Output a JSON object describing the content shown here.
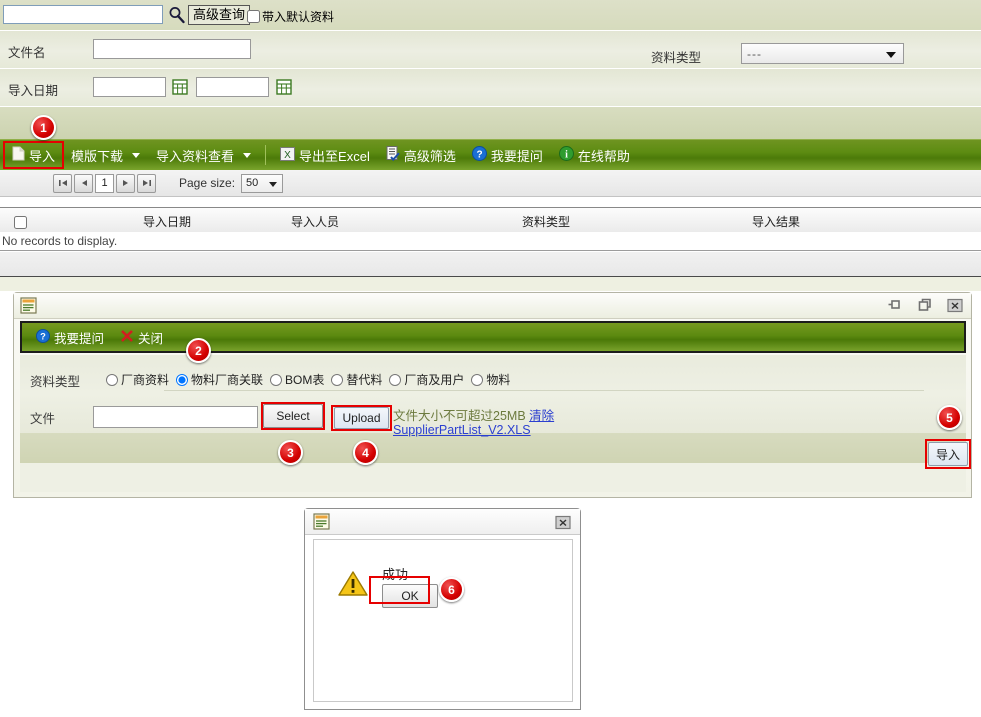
{
  "search": {
    "input_value": "",
    "advanced_query_label": "高级查询",
    "checkbox_label": "带入默认资料",
    "search_icon": "search-icon"
  },
  "filters": {
    "filename_label": "文件名",
    "filename_value": "",
    "import_date_label": "导入日期",
    "date_from": "",
    "date_to": "",
    "doc_type_label": "资料类型",
    "doc_type_value": "---"
  },
  "toolbar": {
    "items": [
      {
        "label": "导入",
        "icon": "import-icon",
        "caret": false
      },
      {
        "label": "模版下载",
        "icon": "",
        "caret": true
      },
      {
        "label": "导入资料查看",
        "icon": "",
        "caret": true
      },
      {
        "label": "导出至Excel",
        "icon": "excel-icon",
        "caret": false
      },
      {
        "label": "高级筛选",
        "icon": "filter-icon",
        "caret": false
      },
      {
        "label": "我要提问",
        "icon": "question-icon",
        "caret": false
      },
      {
        "label": "在线帮助",
        "icon": "info-icon",
        "caret": false
      }
    ]
  },
  "pager": {
    "first_label": "|◀",
    "prev_label": "◀",
    "page_number": "1",
    "next_label": "▶",
    "last_label": "▶|",
    "page_size_label": "Page size:",
    "page_size_value": "50"
  },
  "grid": {
    "columns": [
      "导入日期",
      "导入人员",
      "资料类型",
      "导入结果"
    ],
    "empty_text": "No records to display.",
    "rows": []
  },
  "modal": {
    "title_icon": "document-icon",
    "window_buttons": [
      "pin-icon",
      "restore-icon",
      "close-icon"
    ],
    "toolbar": [
      {
        "label": "我要提问",
        "icon": "question-icon"
      },
      {
        "label": "关闭",
        "icon": "close-x-icon"
      }
    ],
    "doc_type_label": "资料类型",
    "radio_options": [
      {
        "label": "厂商资料",
        "selected": false
      },
      {
        "label": "物料厂商关联",
        "selected": true
      },
      {
        "label": "BOM表",
        "selected": false
      },
      {
        "label": "替代料",
        "selected": false
      },
      {
        "label": "厂商及用户",
        "selected": false
      },
      {
        "label": "物料",
        "selected": false
      }
    ],
    "file_label": "文件",
    "file_input_value": "",
    "select_button": "Select",
    "upload_button": "Upload",
    "size_hint": "文件大小不可超过25MB",
    "clear_link": "清除",
    "uploaded_file": "SupplierPartList_V2.XLS",
    "import_button": "导入"
  },
  "success_dialog": {
    "title_icon": "document-icon",
    "close_icon": "close-icon",
    "warning_icon": "warning-icon",
    "message": "成功",
    "ok_button": "OK"
  },
  "callouts": [
    {
      "number": "1"
    },
    {
      "number": "2"
    },
    {
      "number": "3"
    },
    {
      "number": "4"
    },
    {
      "number": "5"
    },
    {
      "number": "6"
    }
  ],
  "colors": {
    "toolbar_green": "#5d8c12",
    "panel_bg": "#e3e6d4",
    "callout_red": "#e60000",
    "link_blue": "#2b3fd0"
  }
}
